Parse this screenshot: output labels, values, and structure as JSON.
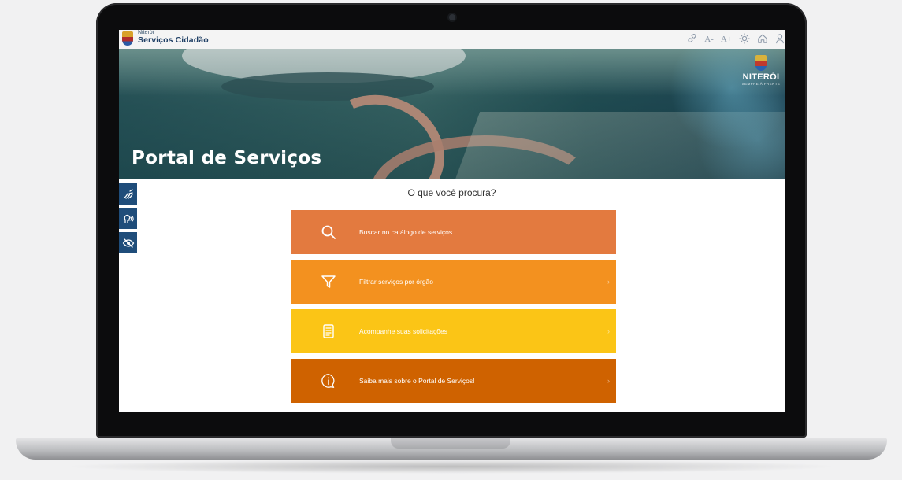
{
  "header": {
    "brand_small": "Niterói",
    "brand_title": "Serviços Cidadão",
    "tools": {
      "font_decrease": "A-",
      "font_increase": "A+"
    }
  },
  "hero": {
    "title": "Portal de Serviços",
    "logo_name": "NITERÓI",
    "logo_tag": "SEMPRE À FRENTE"
  },
  "main": {
    "question": "O que você procura?",
    "items": [
      {
        "label": "Buscar no catálogo de serviços",
        "icon": "search-icon",
        "color": "#e37a3f"
      },
      {
        "label": "Filtrar serviços por órgão",
        "icon": "filter-icon",
        "color": "#f3911f"
      },
      {
        "label": "Acompanhe suas solicitações",
        "icon": "document-icon",
        "color": "#fbc516"
      },
      {
        "label": "Saiba mais sobre o Portal de Serviços!",
        "icon": "info-icon",
        "color": "#cf6200"
      }
    ],
    "chevron": "›"
  },
  "colors": {
    "brand_blue": "#1f4d7a",
    "background": "#ffffff"
  }
}
